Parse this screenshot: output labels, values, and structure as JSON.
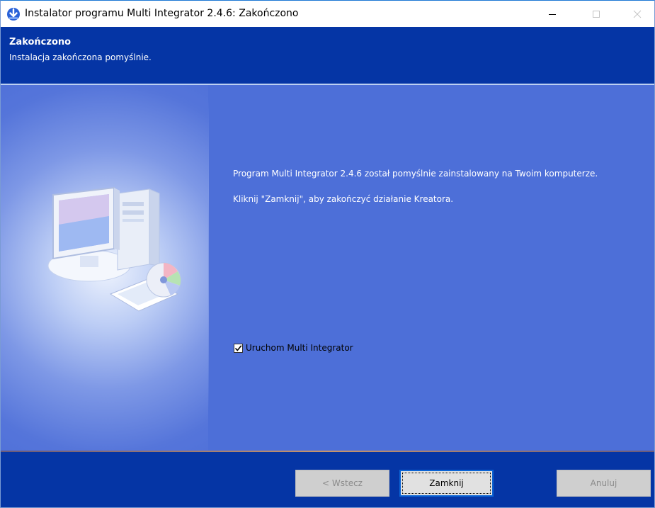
{
  "window": {
    "title": "Instalator programu Multi Integrator 2.4.6: Zakończono",
    "icon": "installer-arrow-icon",
    "controls": [
      "minimize-icon",
      "maximize-icon",
      "close-icon"
    ]
  },
  "header": {
    "title": "Zakończono",
    "subtitle": "Instalacja zakończona pomyślnie."
  },
  "main": {
    "message1": "Program Multi Integrator 2.4.6 został pomyślnie zainstalowany na Twoim komputerze.",
    "message2": "Kliknij \"Zamknij\", aby zakończyć działanie Kreatora.",
    "run_checkbox": {
      "label": "Uruchom Multi Integrator",
      "checked": true
    }
  },
  "footer": {
    "back_label": "< Wstecz",
    "close_label": "Zamknij",
    "cancel_label": "Anuluj"
  },
  "colors": {
    "header_bg": "#0535a5",
    "body_bg": "#4d6fd8",
    "focus_border": "#0a64d6"
  }
}
